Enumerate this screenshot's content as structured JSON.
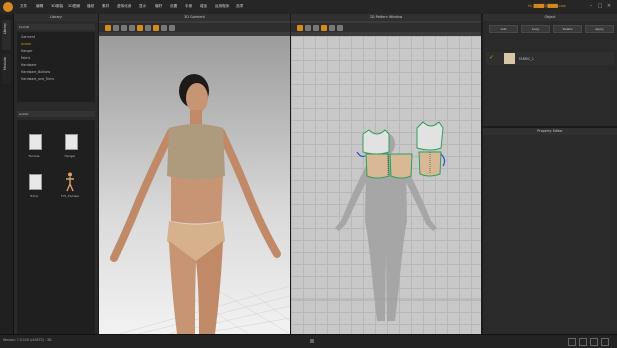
{
  "menubar": {
    "items": [
      "文件",
      "编辑",
      "3D服装",
      "2D图案",
      "缝纫",
      "素材",
      "虚拟化身",
      "显示",
      "偏好",
      "设置",
      "手册",
      "增加",
      "运用程序",
      "选项"
    ],
    "user_label": "Hi, ████@████.com",
    "window_controls": [
      "–",
      "□",
      "×"
    ]
  },
  "side_tabs": [
    "Library",
    "Modular"
  ],
  "library": {
    "title": "Library",
    "header": "CLO3D",
    "tree": [
      "Garment",
      "Avatar",
      "Hanger",
      "Fabric",
      "Hardware",
      "Hardware_Buttons",
      "Hardware_and_Trims"
    ],
    "path": "Avatar",
    "files": [
      {
        "label": "Female",
        "icon": "folder-icon"
      },
      {
        "label": "Hanger",
        "icon": "folder-icon"
      },
      {
        "label": "Trims",
        "icon": "folder-icon"
      },
      {
        "label": "FV1_Female",
        "icon": "avatar-icon"
      }
    ]
  },
  "view3d": {
    "title": "3D Garment"
  },
  "view2d": {
    "title": "2D Pattern Window"
  },
  "object_browser": {
    "title": "Object",
    "buttons": [
      "Add",
      "Copy",
      "Delete",
      "Apply"
    ],
    "fabric_row": "FABRIC_1"
  },
  "property_editor": {
    "title": "Property Editor"
  },
  "statusbar": {
    "text": "Version: 7.0.110 (r44572) · 3D"
  },
  "colors": {
    "accent": "#d98a1c",
    "panel": "#2a2a2a",
    "canvas2d": "#c8c8c8"
  }
}
